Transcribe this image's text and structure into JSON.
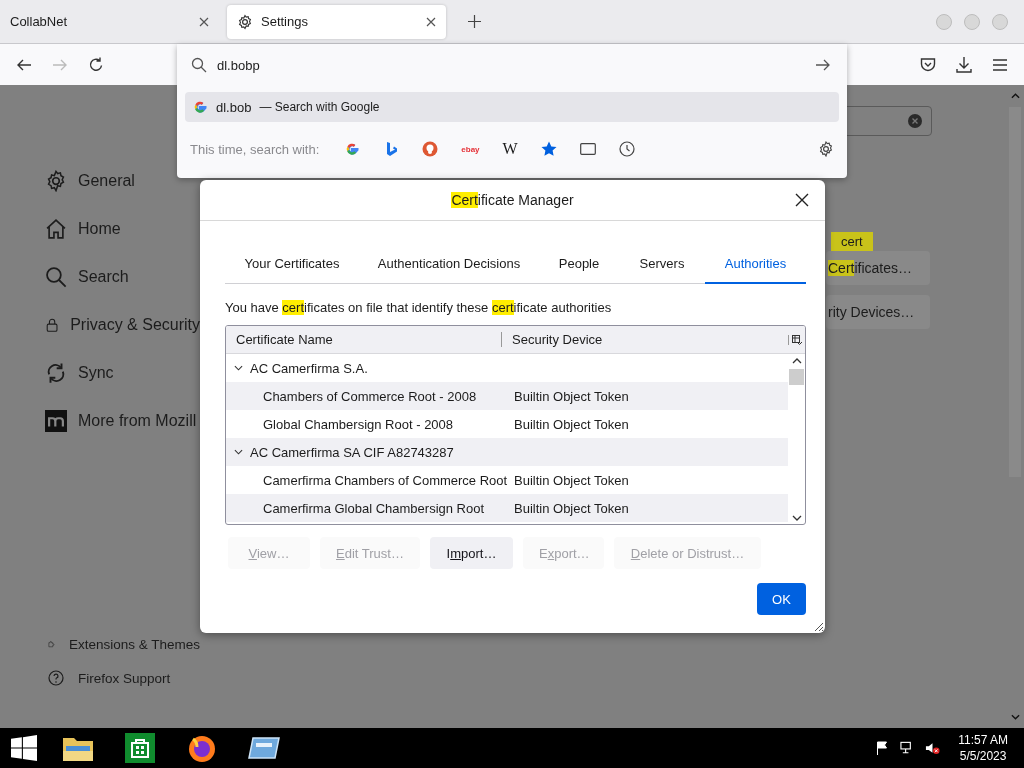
{
  "browser_tabs": [
    {
      "title": "CollabNet",
      "selected": false,
      "kind": "plain"
    },
    {
      "title": "Settings",
      "selected": true,
      "kind": "settings"
    }
  ],
  "address_bar": {
    "value": "dl.bobp"
  },
  "suggestions": [
    {
      "text": "dl.bob",
      "action": "— Search with Google",
      "selected": true
    }
  ],
  "search_with": {
    "label": "This time, search with:",
    "engines": [
      {
        "kind": "google"
      },
      {
        "kind": "bing"
      },
      {
        "kind": "duckduckgo"
      },
      {
        "kind": "ebay",
        "label": "ebay"
      },
      {
        "kind": "wikipedia",
        "label": "W"
      },
      {
        "kind": "bookmarks"
      },
      {
        "kind": "tabs"
      },
      {
        "kind": "history"
      }
    ]
  },
  "sidebar": {
    "items": [
      {
        "label": "General",
        "kind": "gear"
      },
      {
        "label": "Home",
        "kind": "home"
      },
      {
        "label": "Search",
        "kind": "search"
      },
      {
        "label": "Privacy & Security",
        "kind": "lock"
      },
      {
        "label": "Sync",
        "kind": "sync"
      },
      {
        "label": "More from Mozill",
        "kind": "mozilla"
      }
    ],
    "footer": [
      {
        "label": "Extensions & Themes",
        "kind": "puzzle"
      },
      {
        "label": "Firefox Support",
        "kind": "help"
      }
    ]
  },
  "background_page": {
    "highlight_badge": "cert",
    "buttons": [
      {
        "segments": [
          {
            "text": "Cert",
            "highlighted": true
          },
          {
            "text": "ificates…",
            "highlighted": false
          }
        ]
      },
      {
        "segments": [
          {
            "text": "rity ",
            "highlighted": false
          },
          {
            "text": "Devices…",
            "highlighted": false
          }
        ]
      }
    ]
  },
  "dialog": {
    "title": [
      {
        "text": "Cert",
        "highlighted": true
      },
      {
        "text": "ificate Manager",
        "highlighted": false
      }
    ],
    "tabs": [
      {
        "label": "Your Certificates",
        "selected": false
      },
      {
        "label": "Authentication Decisions",
        "selected": false
      },
      {
        "label": "People",
        "selected": false
      },
      {
        "label": "Servers",
        "selected": false
      },
      {
        "label": "Authorities",
        "selected": true
      }
    ],
    "description": [
      {
        "text": "You have ",
        "highlighted": false
      },
      {
        "text": "cert",
        "highlighted": true
      },
      {
        "text": "ificates on file that identify these ",
        "highlighted": false
      },
      {
        "text": "cert",
        "highlighted": true
      },
      {
        "text": "ificate authorities",
        "highlighted": false
      }
    ],
    "table": {
      "columns": [
        "Certificate Name",
        "Security Device"
      ],
      "rows": [
        {
          "name": "AC Camerfirma S.A.",
          "expanded": true,
          "children": [
            {
              "name": "Chambers of Commerce Root - 2008",
              "device": "Builtin Object Token"
            },
            {
              "name": "Global Chambersign Root - 2008",
              "device": "Builtin Object Token"
            }
          ]
        },
        {
          "name": "AC Camerfirma SA CIF A82743287",
          "expanded": true,
          "children": [
            {
              "name": "Camerfirma Chambers of Commerce Root",
              "device": "Builtin Object Token"
            },
            {
              "name": "Camerfirma Global Chambersign Root",
              "device": "Builtin Object Token"
            }
          ]
        }
      ]
    },
    "buttons": [
      {
        "key": "V",
        "post": "iew…",
        "disabled": true
      },
      {
        "key": "E",
        "post": "dit Trust…",
        "disabled": true
      },
      {
        "pre": "I",
        "key": "m",
        "post": "port…",
        "disabled": false
      },
      {
        "pre": "E",
        "key": "x",
        "post": "port…",
        "disabled": true
      },
      {
        "key": "D",
        "post": "elete or Distrust…",
        "disabled": true
      }
    ],
    "ok": "OK"
  },
  "taskbar": {
    "apps": [
      {
        "kind": "folder"
      },
      {
        "kind": "store"
      },
      {
        "kind": "firefox"
      },
      {
        "kind": "window"
      }
    ],
    "time": "11:57 AM",
    "date": "5/5/2023"
  }
}
